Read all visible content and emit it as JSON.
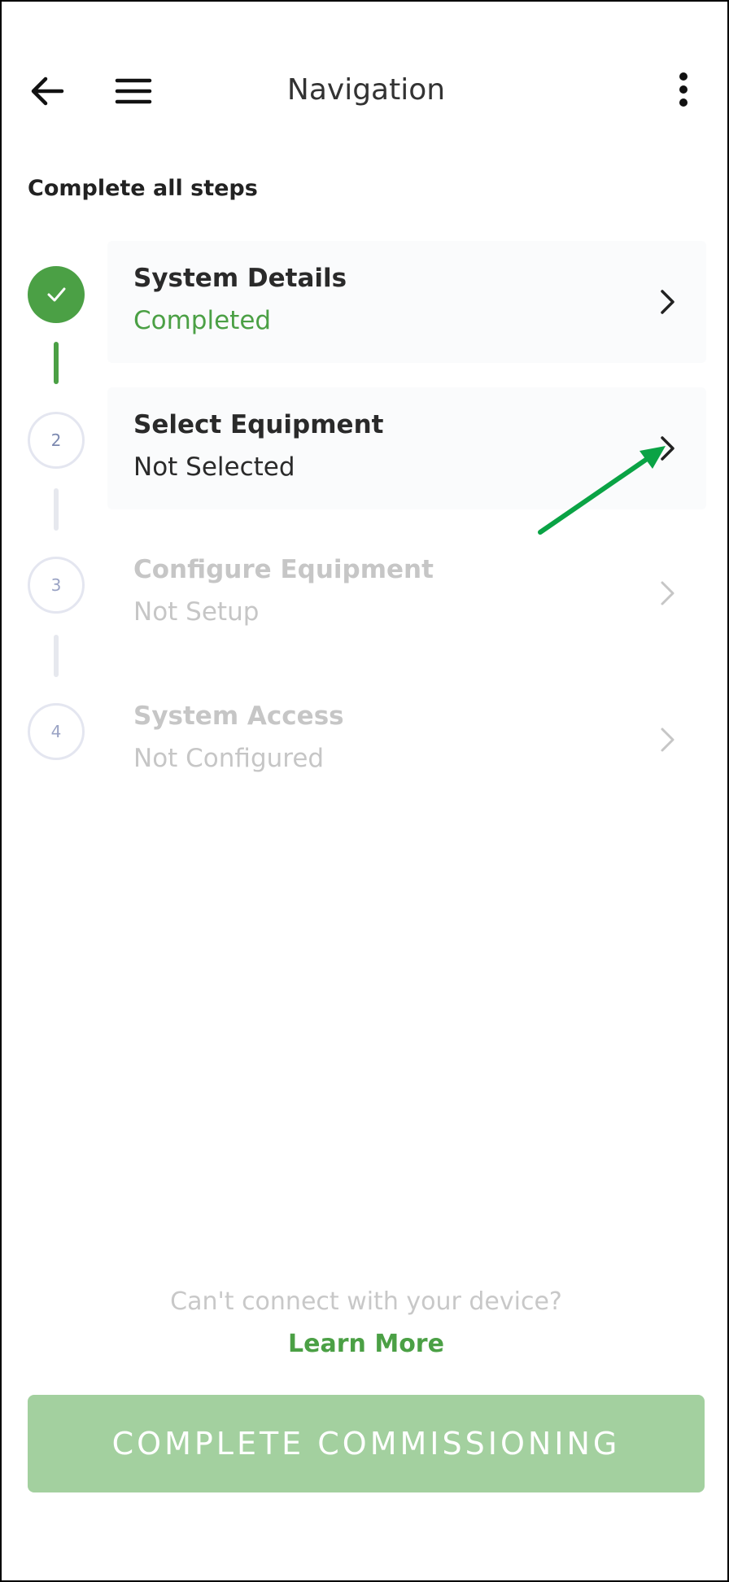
{
  "header": {
    "title": "Navigation",
    "back_icon": "arrow-left-icon",
    "menu_icon": "hamburger-menu-icon",
    "more_icon": "more-vertical-icon"
  },
  "section_title": "Complete all steps",
  "steps": [
    {
      "number": "",
      "title": "System Details",
      "status": "Completed",
      "state": "completed"
    },
    {
      "number": "2",
      "title": "Select Equipment",
      "status": "Not Selected",
      "state": "active"
    },
    {
      "number": "3",
      "title": "Configure Equipment",
      "status": "Not Setup",
      "state": "disabled"
    },
    {
      "number": "4",
      "title": "System Access",
      "status": "Not Configured",
      "state": "disabled"
    }
  ],
  "footer": {
    "help_text": "Can't connect with your device?",
    "learn_more": "Learn More",
    "complete_button": "COMPLETE COMMISSIONING"
  },
  "colors": {
    "accent_green": "#4ba045",
    "button_disabled": "#a3d09f",
    "annotation_arrow": "#0aa345"
  }
}
